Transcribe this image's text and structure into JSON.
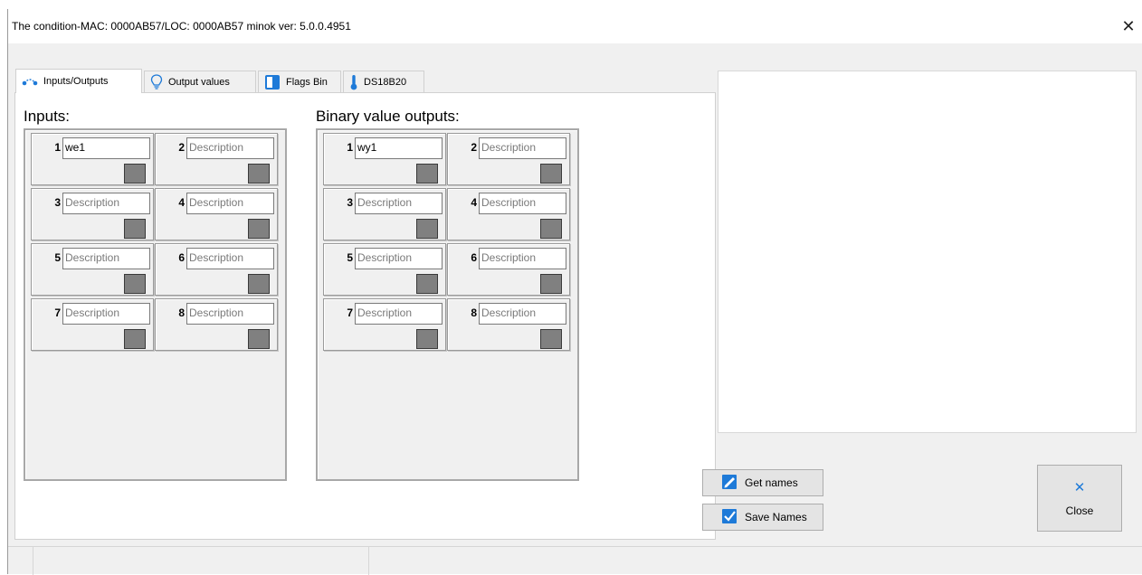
{
  "window": {
    "title": "The condition-MAC: 0000AB57/LOC: 0000AB57 minok ver: 5.0.0.4951",
    "close_glyph": "✕"
  },
  "tabs": [
    {
      "label": "Inputs/Outputs",
      "icon": "io-connection-icon",
      "active": true
    },
    {
      "label": "Output values",
      "icon": "lightbulb-icon",
      "active": false
    },
    {
      "label": "Flags Bin",
      "icon": "flag-bin-icon",
      "active": false
    },
    {
      "label": "DS18B20",
      "icon": "thermometer-icon",
      "active": false
    }
  ],
  "inputs": {
    "title": "Inputs:",
    "cells": [
      {
        "num": "1",
        "text": "we1",
        "state": "off"
      },
      {
        "num": "2",
        "text": "Description",
        "state": "off"
      },
      {
        "num": "3",
        "text": "Description",
        "state": "off"
      },
      {
        "num": "4",
        "text": "Description",
        "state": "off"
      },
      {
        "num": "5",
        "text": "Description",
        "state": "off"
      },
      {
        "num": "6",
        "text": "Description",
        "state": "off"
      },
      {
        "num": "7",
        "text": "Description",
        "state": "off"
      },
      {
        "num": "8",
        "text": "Description",
        "state": "off"
      }
    ]
  },
  "outputs": {
    "title": "Binary value outputs:",
    "cells": [
      {
        "num": "1",
        "text": "wy1",
        "state": "off"
      },
      {
        "num": "2",
        "text": "Description",
        "state": "off"
      },
      {
        "num": "3",
        "text": "Description",
        "state": "off"
      },
      {
        "num": "4",
        "text": "Description",
        "state": "off"
      },
      {
        "num": "5",
        "text": "Description",
        "state": "off"
      },
      {
        "num": "6",
        "text": "Description",
        "state": "off"
      },
      {
        "num": "7",
        "text": "Description",
        "state": "off"
      },
      {
        "num": "8",
        "text": "Description",
        "state": "off"
      }
    ]
  },
  "buttons": {
    "get_names": "Get names",
    "save_names": "Save Names",
    "close": "Close",
    "close_glyph": "✕"
  },
  "colors": {
    "led_off": "#808080",
    "icon_blue": "#1e7ad8"
  }
}
